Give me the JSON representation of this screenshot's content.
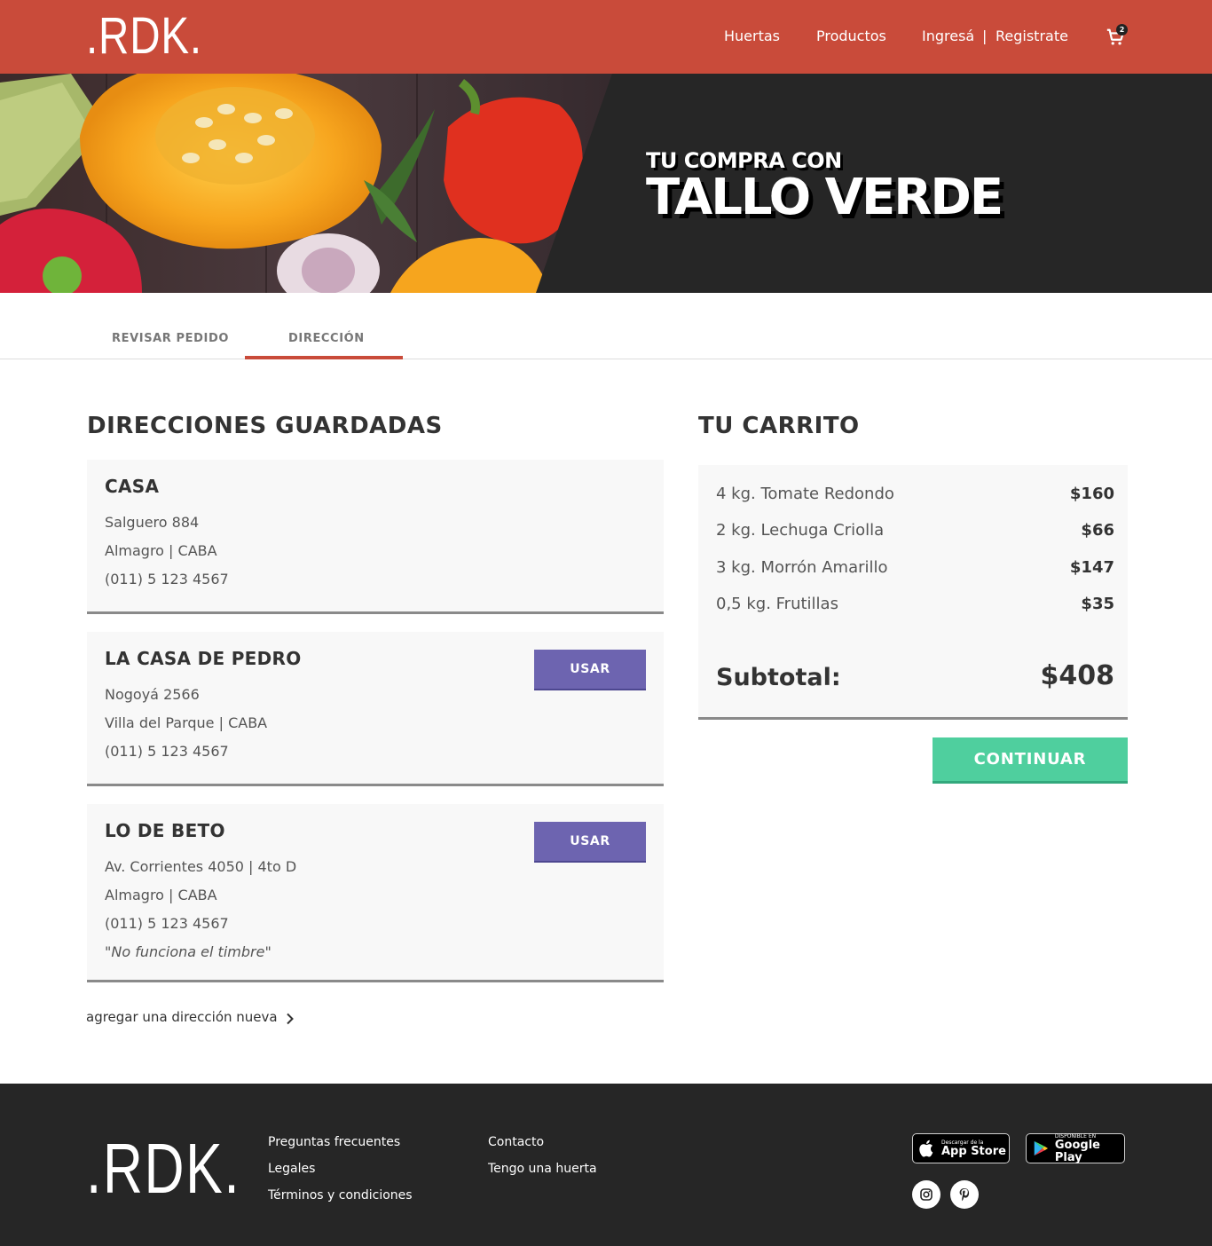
{
  "header": {
    "logo": ".RDK.",
    "nav": {
      "huertas": "Huertas",
      "productos": "Productos",
      "ingresa": "Ingresá",
      "separator": "|",
      "registrate": "Registrate"
    },
    "cart_count": "2",
    "bg_color": "#c94b3a"
  },
  "hero": {
    "kicker": "TU COMPRA CON",
    "title": "TALLO VERDE"
  },
  "tabs": [
    {
      "label": "REVISAR PEDIDO"
    },
    {
      "label": "DIRECCIÓN"
    }
  ],
  "addresses": {
    "title": "DIRECCIONES GUARDADAS",
    "items": [
      {
        "name": "CASA",
        "street": "Salguero 884",
        "area": "Almagro  |  CABA",
        "phone": "(011) 5 123 4567"
      },
      {
        "name": "LA CASA DE PEDRO",
        "street": "Nogoyá 2566",
        "area": "Villa del Parque  |  CABA",
        "phone": "(011) 5 123 4567",
        "button": "USAR"
      },
      {
        "name": "LO DE BETO",
        "street": "Av. Corrientes 4050  |  4to D",
        "area": "Almagro  |  CABA",
        "phone": "(011) 5 123 4567",
        "note": "\"No funciona el timbre\"",
        "button": "USAR"
      }
    ],
    "add_new": "agregar una dirección nueva"
  },
  "cart": {
    "title": "TU CARRITO",
    "items": [
      {
        "desc": "4 kg.  Tomate Redondo",
        "price": "$160"
      },
      {
        "desc": "2 kg.  Lechuga Criolla",
        "price": "$66"
      },
      {
        "desc": "3 kg.  Morrón Amarillo",
        "price": "$147"
      },
      {
        "desc": "0,5 kg.  Frutillas",
        "price": "$35"
      }
    ],
    "subtotal_label": "Subtotal:",
    "subtotal_value": "$408",
    "continue": "CONTINUAR"
  },
  "footer": {
    "logo": ".RDK.",
    "links_col1": [
      "Preguntas frecuentes",
      "Legales",
      "Términos y condiciones"
    ],
    "links_col2": [
      "Contacto",
      "Tengo una huerta"
    ],
    "app_store": {
      "small": "Descargar de la",
      "big": "App Store"
    },
    "google_play": {
      "small": "DISPONIBLE EN",
      "big": "Google Play"
    }
  },
  "colors": {
    "accent_red": "#c94b3a",
    "use_button": "#6d64b0",
    "continue_button": "#4fcf9e",
    "dark": "#262626"
  }
}
